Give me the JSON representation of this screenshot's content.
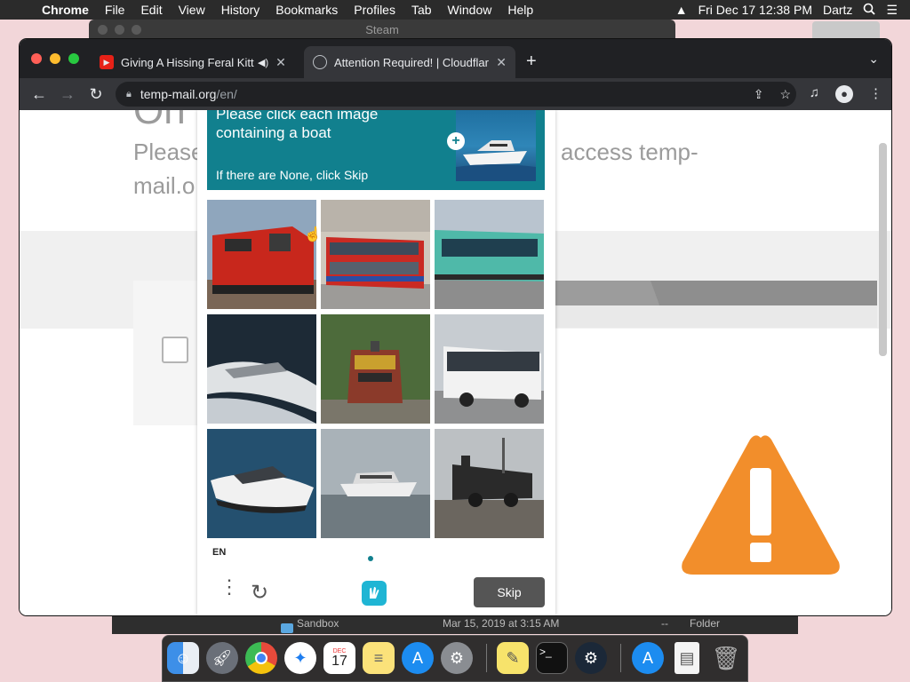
{
  "menubar": {
    "app": "Chrome",
    "items": [
      "File",
      "Edit",
      "View",
      "History",
      "Bookmarks",
      "Profiles",
      "Tab",
      "Window",
      "Help"
    ],
    "datetime": "Fri Dec 17  12:38 PM",
    "user": "Dartz"
  },
  "bg_windows": {
    "steam_title": "Steam",
    "finder_row": {
      "name": "Sandbox",
      "date": "Mar 15, 2019 at 3:15 AM",
      "size": "--",
      "kind": "Folder"
    }
  },
  "browser": {
    "tabs": [
      {
        "title": "Giving A Hissing Feral Kitten",
        "favicon": "youtube-icon",
        "active": false,
        "audio": true
      },
      {
        "title": "Attention Required! | Cloudflare",
        "favicon": "globe-icon",
        "active": true,
        "audio": false
      }
    ],
    "url_domain": "temp-mail.org",
    "url_path": "/en/"
  },
  "page": {
    "bg_text_left_1": "Please",
    "bg_text_left_2": "mail.o",
    "bg_text_right": "access temp-",
    "bg_heading_fragment": "On"
  },
  "captcha": {
    "prompt": "Please click each image containing a boat",
    "hint": "If there are None, click Skip",
    "language": "EN",
    "skip_label": "Skip",
    "accent": "#11808e",
    "images": [
      "red freight locomotive",
      "red double-decker bus",
      "teal city bus",
      "speedboat",
      "yellow locomotive in forest",
      "white coach bus",
      "white speedboat on water",
      "white yacht",
      "black steam locomotive"
    ]
  },
  "dock": {
    "apps": [
      "Finder",
      "Launchpad",
      "Google Chrome",
      "Safari",
      "Calendar",
      "Notes",
      "App Store",
      "System Preferences",
      "Stickies",
      "Terminal",
      "Steam",
      "App Store",
      "Document",
      "Trash"
    ],
    "calendar_month": "DEC",
    "calendar_day": "17"
  }
}
